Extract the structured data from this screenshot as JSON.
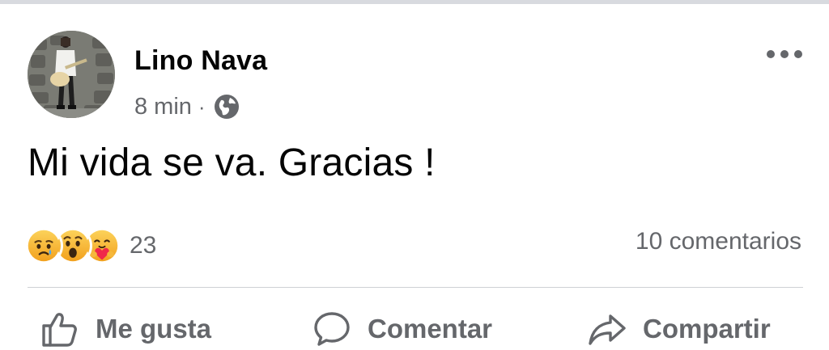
{
  "post": {
    "author": {
      "name": "Lino Nava",
      "avatar_icon": "profile-photo-guitarist"
    },
    "timestamp": "8 min",
    "separator": "·",
    "audience_icon": "globe-icon",
    "text": "Mi vida se va. Gracias !",
    "reactions": {
      "types": [
        "sad",
        "wow",
        "care"
      ],
      "count": "23"
    },
    "comments_label": "10 comentarios",
    "more_icon": "ellipsis-icon"
  },
  "actions": {
    "like_label": "Me gusta",
    "comment_label": "Comentar",
    "share_label": "Compartir"
  },
  "colors": {
    "text_primary": "#050505",
    "text_secondary": "#65676b",
    "divider": "#ced0d4",
    "reaction_yellow": "#f7b125",
    "care_heart": "#f0284a"
  }
}
